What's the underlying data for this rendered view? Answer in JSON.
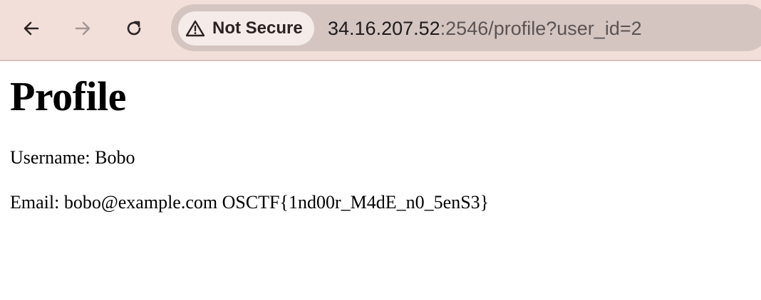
{
  "browser": {
    "back_icon": "arrow-left-icon",
    "forward_icon": "arrow-right-icon",
    "reload_icon": "reload-icon",
    "security": {
      "icon": "warning-triangle-icon",
      "label": "Not Secure"
    },
    "url": {
      "host": "34.16.207.52",
      "rest": ":2546/profile?user_id=2"
    },
    "colors": {
      "toolbar": "#f3dfda",
      "omnibox": "#d4c5c1",
      "chip": "#f5ebe8"
    }
  },
  "page": {
    "title": "Profile",
    "username_line": "Username: Bobo",
    "email_line": "Email: bobo@example.com OSCTF{1nd00r_M4dE_n0_5enS3}"
  }
}
